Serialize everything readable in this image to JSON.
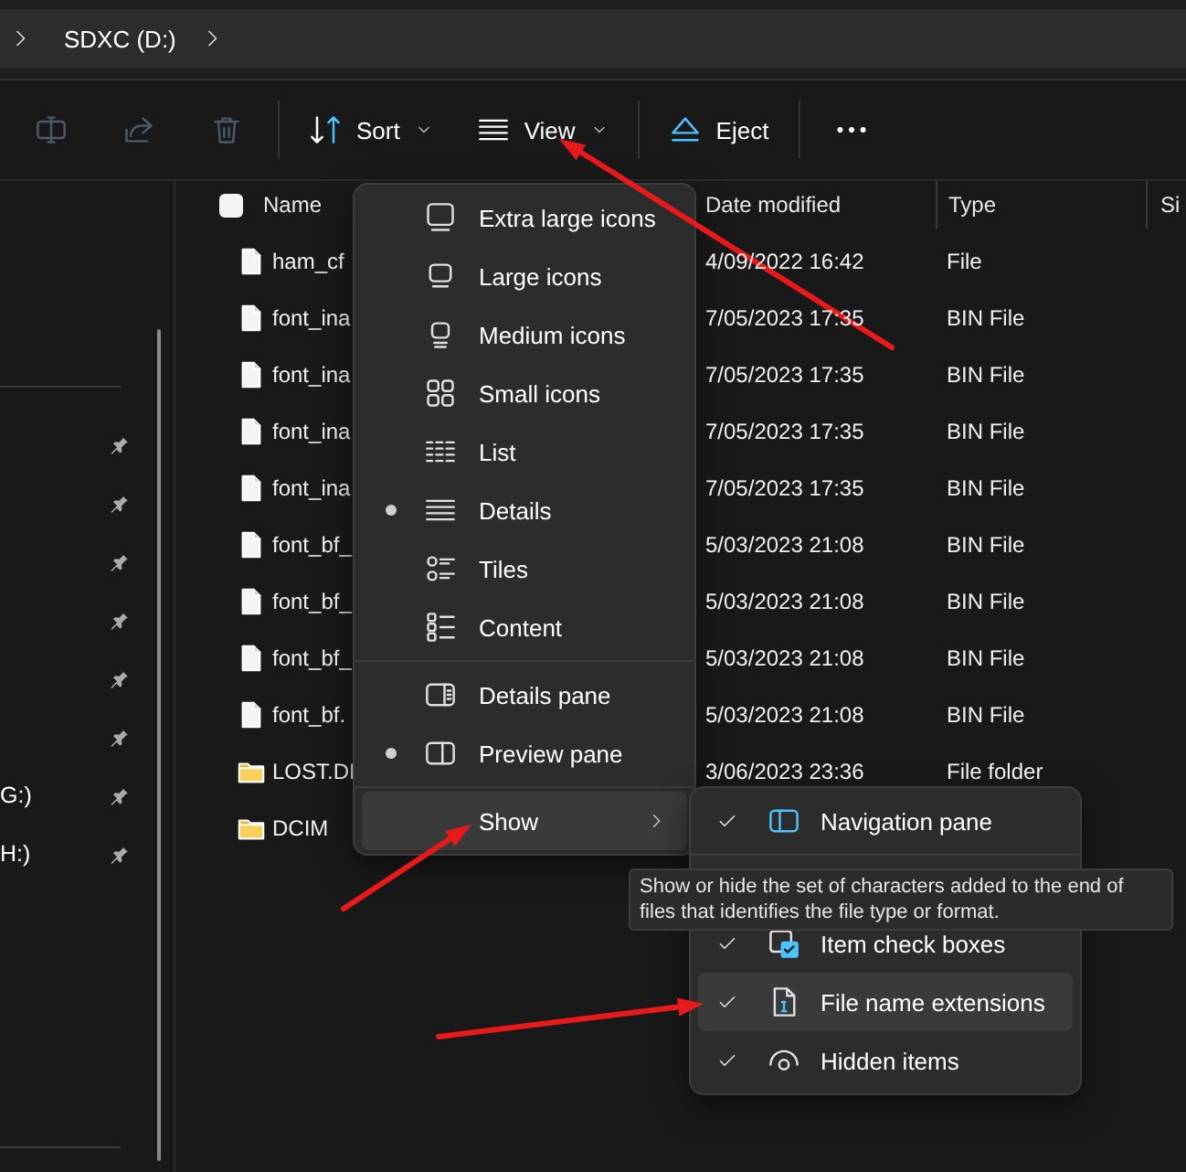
{
  "address_bar": {
    "segments": [
      "SDXC (D:)"
    ]
  },
  "toolbar": {
    "actions": [
      {
        "kind": "rename",
        "disabled": true
      },
      {
        "kind": "share",
        "disabled": true
      },
      {
        "kind": "delete",
        "disabled": true
      },
      {
        "kind": "sort",
        "label": "Sort",
        "dropdown": true,
        "disabled": false
      },
      {
        "kind": "view",
        "label": "View",
        "dropdown": true,
        "disabled": false
      },
      {
        "kind": "eject",
        "label": "Eject",
        "dropdown": false,
        "disabled": false
      },
      {
        "kind": "more",
        "disabled": false
      }
    ]
  },
  "sidebar": {
    "items": [
      {
        "pinned": true
      },
      {
        "pinned": true
      },
      {
        "pinned": true
      },
      {
        "pinned": true
      },
      {
        "pinned": true
      },
      {
        "pinned": true
      },
      {
        "label": "G:)",
        "pinned": true
      },
      {
        "label": "H:)",
        "pinned": true
      }
    ]
  },
  "table": {
    "columns": [
      {
        "label": "Name"
      },
      {
        "label": "Date modified"
      },
      {
        "label": "Type"
      },
      {
        "label": "Si"
      }
    ],
    "select_all": {
      "checked": false
    },
    "rows": [
      {
        "kind": "file",
        "name": "ham_cf",
        "date": "4/09/2022 16:42",
        "type": "File"
      },
      {
        "kind": "file",
        "name": "font_ina",
        "date": "7/05/2023 17:35",
        "type": "BIN File"
      },
      {
        "kind": "file",
        "name": "font_ina",
        "date": "7/05/2023 17:35",
        "type": "BIN File"
      },
      {
        "kind": "file",
        "name": "font_ina",
        "date": "7/05/2023 17:35",
        "type": "BIN File"
      },
      {
        "kind": "file",
        "name": "font_ina",
        "date": "7/05/2023 17:35",
        "type": "BIN File"
      },
      {
        "kind": "file",
        "name": "font_bf_",
        "date": "5/03/2023 21:08",
        "type": "BIN File"
      },
      {
        "kind": "file",
        "name": "font_bf_",
        "date": "5/03/2023 21:08",
        "type": "BIN File"
      },
      {
        "kind": "file",
        "name": "font_bf_",
        "date": "5/03/2023 21:08",
        "type": "BIN File"
      },
      {
        "kind": "file",
        "name": "font_bf.",
        "date": "5/03/2023 21:08",
        "type": "BIN File"
      },
      {
        "kind": "folder",
        "name": "LOST.DI",
        "date": "3/06/2023 23:36",
        "type": "File folder"
      },
      {
        "kind": "folder",
        "name": "DCIM"
      }
    ]
  },
  "view_menu": {
    "groups": [
      {
        "items": [
          {
            "kind": "extra-large",
            "label": "Extra large icons",
            "selected": false,
            "hovered": false
          },
          {
            "kind": "large",
            "label": "Large icons",
            "selected": false,
            "hovered": false
          },
          {
            "kind": "medium",
            "label": "Medium icons",
            "selected": false,
            "hovered": false
          },
          {
            "kind": "small",
            "label": "Small icons",
            "selected": false,
            "hovered": false
          },
          {
            "kind": "list",
            "label": "List",
            "selected": false,
            "hovered": false
          },
          {
            "kind": "details",
            "label": "Details",
            "selected": true,
            "hovered": false
          },
          {
            "kind": "tiles",
            "label": "Tiles",
            "selected": false,
            "hovered": false
          },
          {
            "kind": "content",
            "label": "Content",
            "selected": false,
            "hovered": false
          }
        ]
      },
      {
        "items": [
          {
            "kind": "details-pane",
            "label": "Details pane",
            "selected": false,
            "hovered": false
          },
          {
            "kind": "preview-pane",
            "label": "Preview pane",
            "selected": true,
            "hovered": false
          }
        ]
      },
      {
        "items": [
          {
            "kind": "submenu",
            "label": "Show",
            "selected": false,
            "hovered": true
          }
        ]
      }
    ]
  },
  "show_menu": {
    "groups": [
      {
        "items": [
          {
            "kind": "navigation",
            "label": "Navigation pane",
            "checked": true,
            "hovered": false
          }
        ]
      },
      {
        "items": [
          {
            "kind": "checkboxes",
            "label": "Item check boxes",
            "checked": true,
            "hovered": false
          },
          {
            "kind": "extensions",
            "label": "File name extensions",
            "checked": true,
            "hovered": true
          },
          {
            "kind": "hidden",
            "label": "Hidden items",
            "checked": true,
            "hovered": false
          }
        ]
      }
    ]
  },
  "tooltip": {
    "text": "Show or hide the set of characters added to the end of files that identifies the file type or format."
  }
}
